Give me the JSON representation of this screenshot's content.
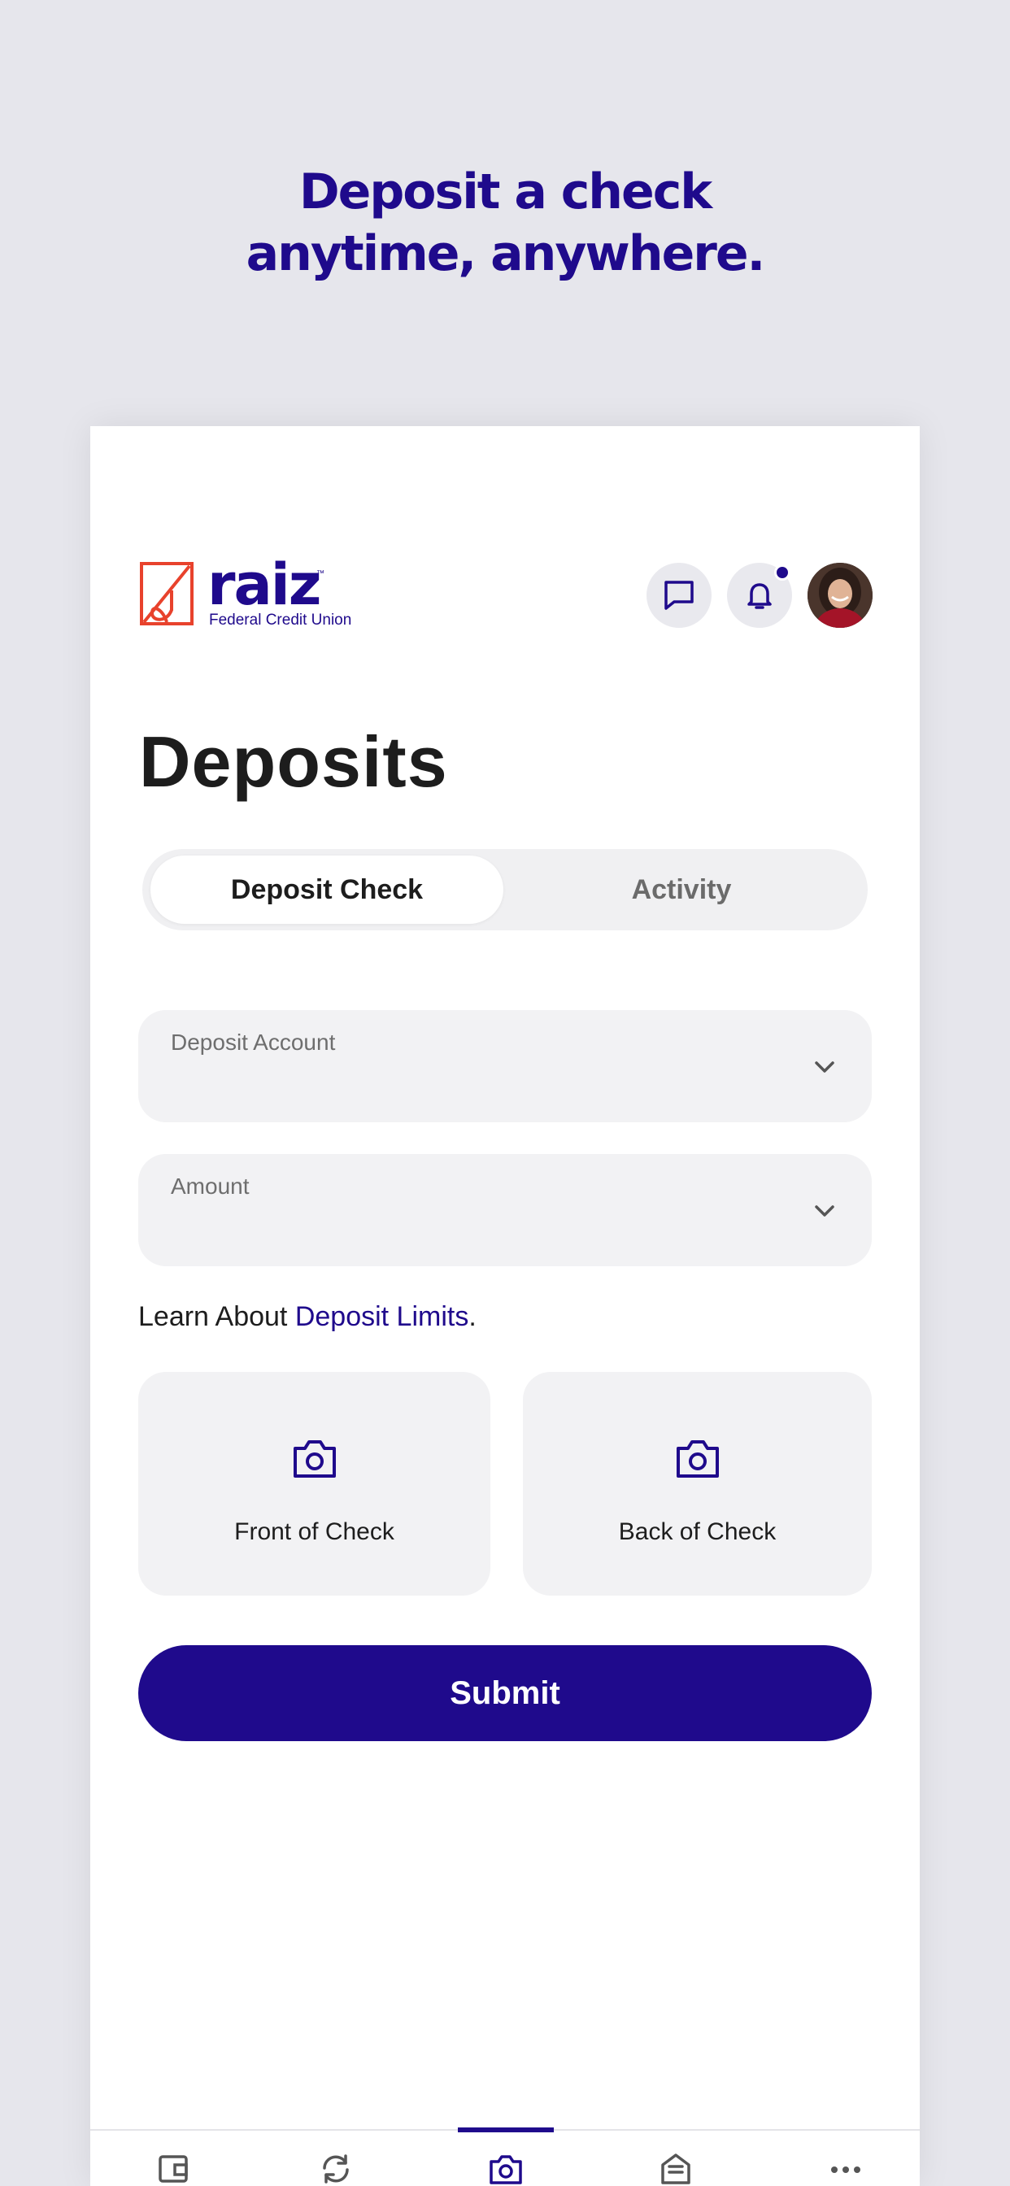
{
  "promo": {
    "headline_line1": "Deposit a check",
    "headline_line2": "anytime, anywhere."
  },
  "header": {
    "logo_word": "raiz",
    "logo_tm": "™",
    "logo_sub": "Federal Credit Union",
    "chat_icon": "chat-bubble-icon",
    "bell_icon": "bell-icon",
    "has_unread_notification": true
  },
  "page": {
    "title": "Deposits"
  },
  "tabs": {
    "active_label": "Deposit Check",
    "inactive_label": "Activity"
  },
  "form": {
    "account_label": "Deposit Account",
    "amount_label": "Amount",
    "limits_prefix": "Learn About ",
    "limits_link": "Deposit Limits",
    "limits_suffix": ".",
    "front_label": "Front of Check",
    "back_label": "Back of Check",
    "submit_label": "Submit"
  },
  "bottom_nav": {
    "items": [
      {
        "icon": "wallet-icon",
        "active": false
      },
      {
        "icon": "transfer-icon",
        "active": false
      },
      {
        "icon": "camera-icon",
        "active": true
      },
      {
        "icon": "inbox-icon",
        "active": false
      },
      {
        "icon": "more-icon",
        "active": false
      }
    ]
  },
  "colors": {
    "brand": "#1f0a8c",
    "logo_red": "#e8422c",
    "background": "#e6e6ec",
    "field_bg": "#f2f2f4"
  }
}
